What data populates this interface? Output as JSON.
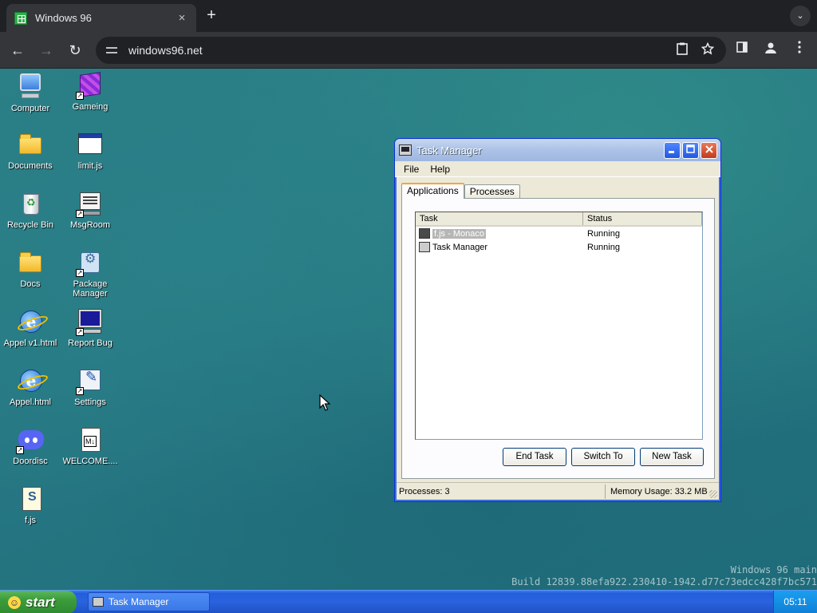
{
  "browser": {
    "tab_title": "Windows 96",
    "tab_close": "×",
    "new_tab": "+",
    "tab_menu": "⌄",
    "url": "windows96.net",
    "back": "←",
    "forward": "→",
    "reload": "↻"
  },
  "desktop": {
    "icons": [
      {
        "label": "Computer",
        "icon": "computer-icon"
      },
      {
        "label": "Gameing",
        "icon": "cube-icon"
      },
      {
        "label": "Documents",
        "icon": "documents-icon"
      },
      {
        "label": "limit.js",
        "icon": "window-icon"
      },
      {
        "label": "Recycle Bin",
        "icon": "recycle-bin-icon"
      },
      {
        "label": "MsgRoom",
        "icon": "msgroom-icon"
      },
      {
        "label": "Docs",
        "icon": "folder-icon"
      },
      {
        "label": "Package Manager",
        "icon": "package-manager-icon"
      },
      {
        "label": "Appel v1.html",
        "icon": "ie-icon"
      },
      {
        "label": "Report Bug",
        "icon": "monitor-icon"
      },
      {
        "label": "Appel.html",
        "icon": "ie-icon"
      },
      {
        "label": "Settings",
        "icon": "settings-icon"
      },
      {
        "label": "Doordisc",
        "icon": "discord-icon"
      },
      {
        "label": "WELCOME....",
        "icon": "markdown-icon"
      },
      {
        "label": "f.js",
        "icon": "js-file-icon"
      }
    ]
  },
  "task_manager": {
    "title": "Task Manager",
    "menu": [
      "File",
      "Help"
    ],
    "tabs": [
      "Applications",
      "Processes"
    ],
    "columns": [
      "Task",
      "Status"
    ],
    "rows": [
      {
        "task": "f.js - Monaco",
        "status": "Running"
      },
      {
        "task": "Task Manager",
        "status": "Running"
      }
    ],
    "buttons": {
      "end_task": "End Task",
      "switch_to": "Switch To",
      "new_task": "New Task"
    },
    "status_processes": "Processes: 3",
    "status_memory": "Memory Usage: 33.2 MB"
  },
  "watermark": {
    "line1": "Windows 96 main",
    "line2": "Build 12839.88efa922.230410-1942.d77c73edcc428f7bc571"
  },
  "taskbar": {
    "start_label": "start",
    "task_button": "Task Manager",
    "clock": "05:11"
  },
  "colors": {
    "taskbar_blue": "#245edb",
    "start_green": "#3b9c3b",
    "desktop_teal": "#267883"
  }
}
